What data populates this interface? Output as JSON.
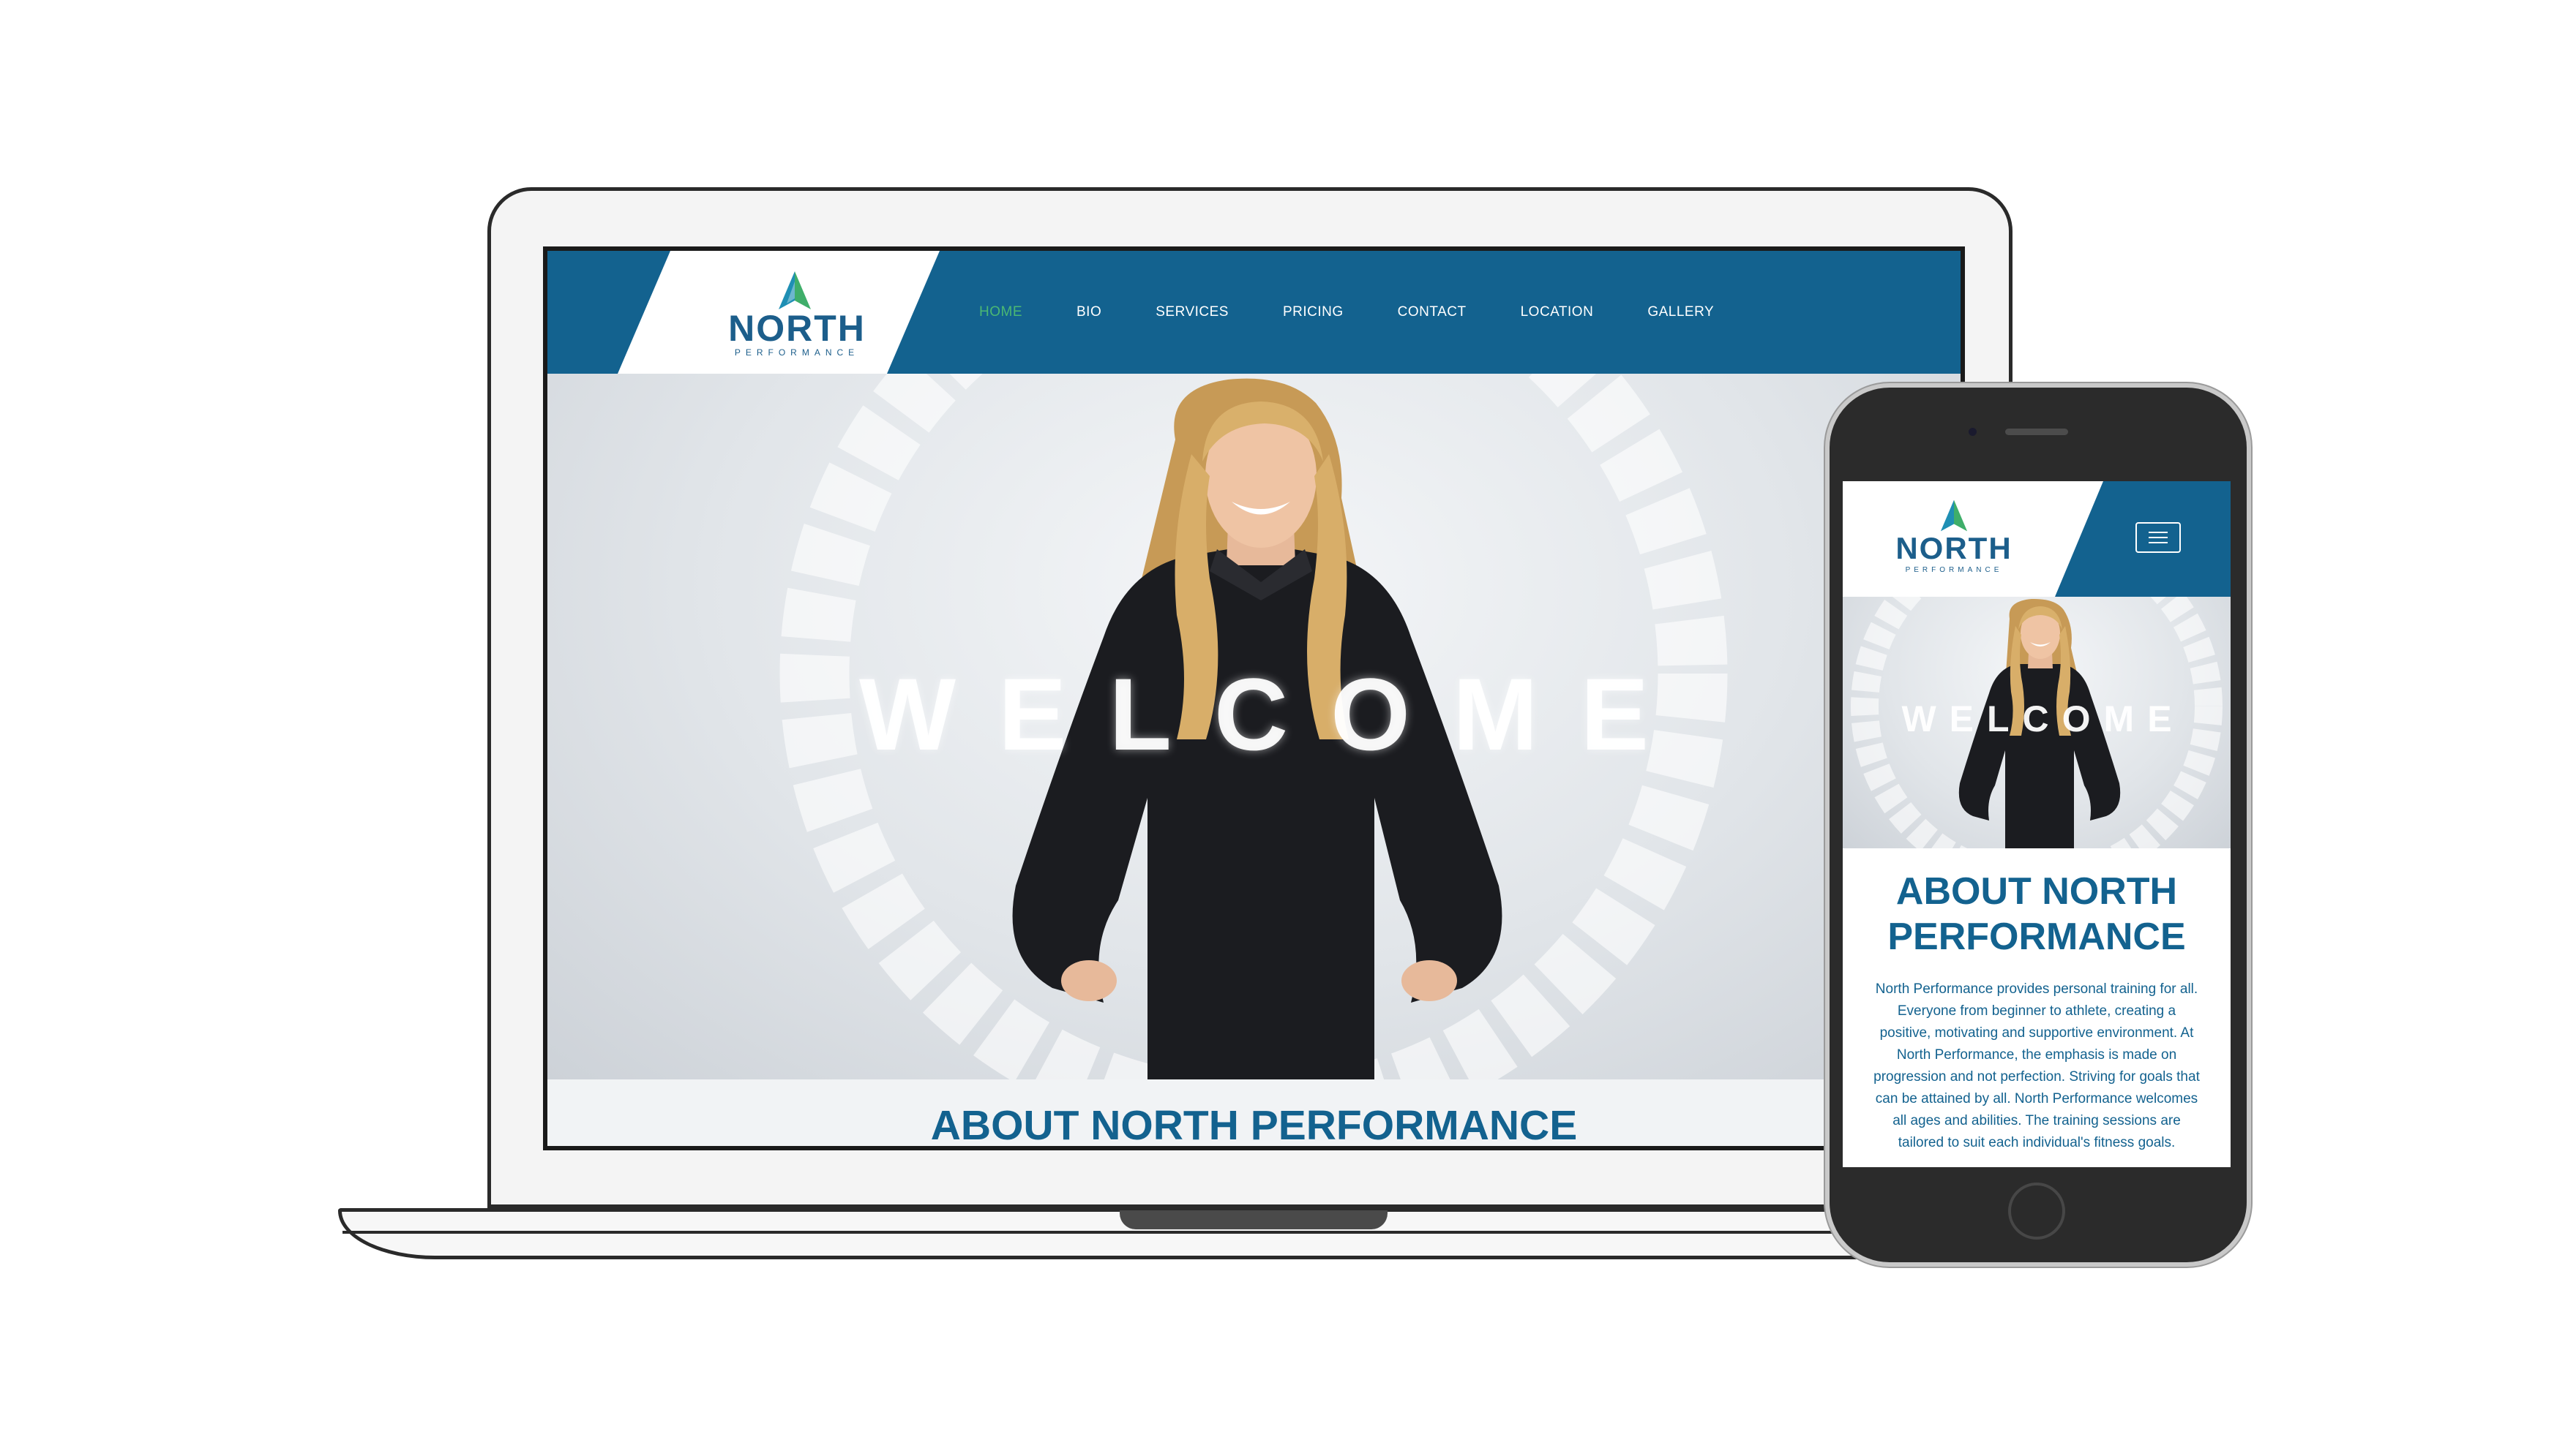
{
  "brand": {
    "name": "NORTH",
    "tagline": "PERFORMANCE",
    "colors": {
      "primary_blue": "#13628f",
      "active_green": "#4bb873",
      "logo_teal": "#1f8fb4",
      "logo_green": "#3fae6a"
    }
  },
  "desktop": {
    "nav": {
      "items": [
        "HOME",
        "BIO",
        "SERVICES",
        "PRICING",
        "CONTACT",
        "LOCATION",
        "GALLERY"
      ],
      "active_index": 0
    },
    "hero": {
      "headline": "WELCOME"
    },
    "about": {
      "title": "ABOUT NORTH PERFORMANCE"
    }
  },
  "mobile": {
    "menu_icon": "hamburger-icon",
    "hero": {
      "headline": "WELCOME"
    },
    "about": {
      "title": "ABOUT NORTH PERFORMANCE",
      "body": "North Performance provides personal training for all. Everyone from beginner to athlete, creating a positive, motivating and supportive environment. At North Performance, the emphasis is made on progression and not perfection. Striving for goals that can be attained by all. North Performance welcomes all ages and abilities. The training sessions are tailored to suit each individual's fitness goals."
    }
  }
}
